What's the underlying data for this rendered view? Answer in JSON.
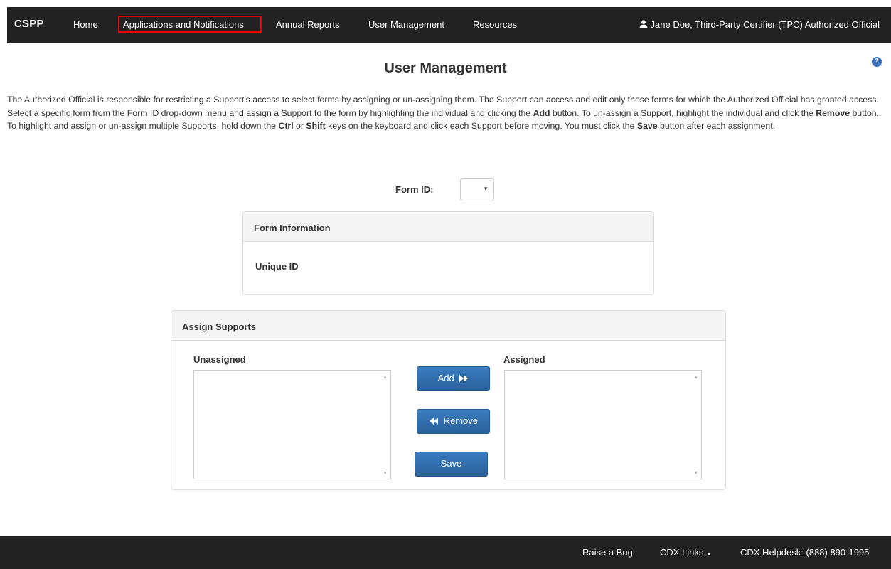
{
  "navbar": {
    "brand": "CSPP",
    "items": [
      {
        "label": "Home"
      },
      {
        "label": "Applications and Notifications"
      },
      {
        "label": "Annual Reports"
      },
      {
        "label": "User Management"
      },
      {
        "label": "Resources"
      }
    ],
    "user": "Jane Doe, Third-Party Certifier (TPC) Authorized Official"
  },
  "page": {
    "title": "User Management",
    "help_icon": "question-circle-icon",
    "intro": {
      "p1": "The Authorized Official is responsible for restricting a Support's access to select forms by assigning or un-assigning them. The Support can access and edit only those forms for which the Authorized Official has granted access. Select a specific form from the Form ID drop-down menu and assign a Support to the form by highlighting the individual and clicking the ",
      "b1": "Add",
      "p2": " button. To un-assign a Support, highlight the individual and click the ",
      "b2": "Remove",
      "p3": " button. To highlight and assign or un-assign multiple Supports, hold down the ",
      "b3": "Ctrl",
      "p4": " or ",
      "b4": "Shift",
      "p5": " keys on the keyboard and click each Support before moving. You must click the ",
      "b5": "Save",
      "p6": " button after each assignment."
    }
  },
  "form_id": {
    "label": "Form ID:",
    "value": ""
  },
  "form_info": {
    "heading": "Form Information",
    "unique_id_label": "Unique ID"
  },
  "assign": {
    "heading": "Assign Supports",
    "unassigned_label": "Unassigned",
    "assigned_label": "Assigned",
    "add_label": "Add",
    "remove_label": "Remove",
    "save_label": "Save"
  },
  "footer": {
    "raise_bug": "Raise a Bug",
    "cdx_links": "CDX Links",
    "helpdesk": "CDX Helpdesk: (888) 890-1995"
  },
  "colors": {
    "nav_bg": "#222222",
    "primary_button": "#2e6ba8",
    "highlight_border": "#ee0000",
    "help_icon": "#3a6fbf"
  }
}
